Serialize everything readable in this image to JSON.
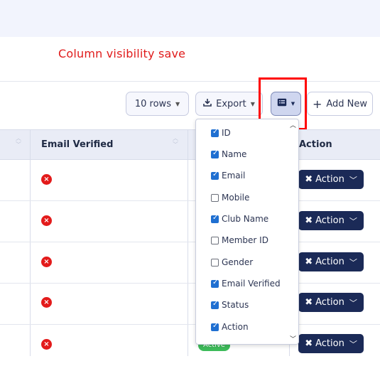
{
  "annotation": "Column visibility save",
  "toolbar": {
    "rows_label": "10 rows",
    "export_label": "Export",
    "add_new_label": "Add New"
  },
  "table": {
    "headers": {
      "email_verified": "Email Verified",
      "action": "Action"
    },
    "rows": [
      {
        "email_verified_icon": "x-circle-icon",
        "action_label": "Action"
      },
      {
        "email_verified_icon": "x-circle-icon",
        "action_label": "Action"
      },
      {
        "email_verified_icon": "x-circle-icon",
        "action_label": "Action"
      },
      {
        "email_verified_icon": "x-circle-icon",
        "action_label": "Action"
      },
      {
        "email_verified_icon": "x-circle-icon",
        "action_label": "Action"
      }
    ],
    "partial_badge": "Active"
  },
  "column_menu": [
    {
      "label": "ID",
      "checked": true
    },
    {
      "label": "Name",
      "checked": true
    },
    {
      "label": "Email",
      "checked": true
    },
    {
      "label": "Mobile",
      "checked": false
    },
    {
      "label": "Club Name",
      "checked": true
    },
    {
      "label": "Member ID",
      "checked": false
    },
    {
      "label": "Gender",
      "checked": false
    },
    {
      "label": "Email Verified",
      "checked": true
    },
    {
      "label": "Status",
      "checked": true
    },
    {
      "label": "Action",
      "checked": true
    }
  ],
  "colors": {
    "accent": "#1b2a57",
    "highlight": "#ff0000",
    "error": "#e31b1b",
    "checkbox": "#1f6fd1"
  }
}
